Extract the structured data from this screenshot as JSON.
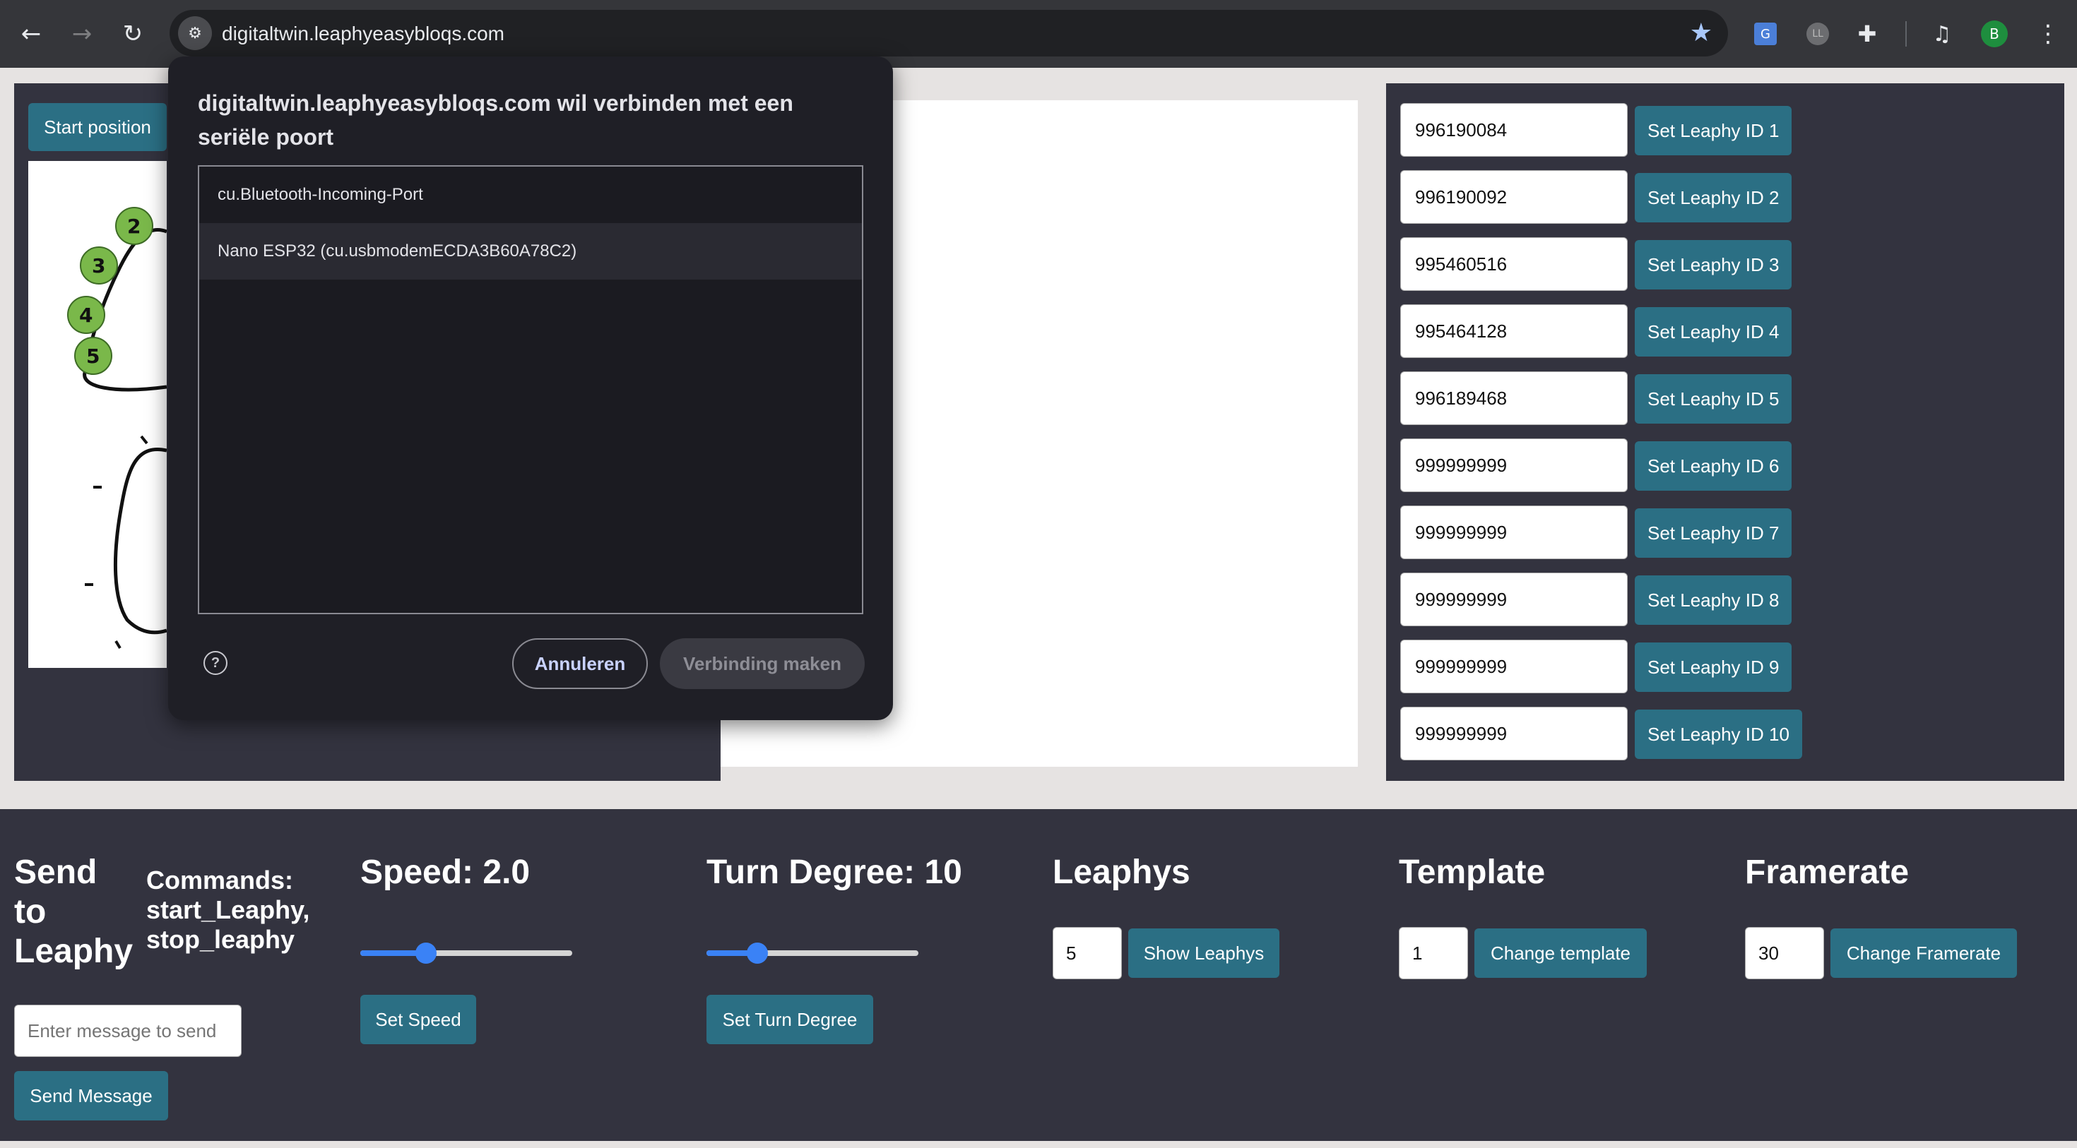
{
  "browser": {
    "url": "digitaltwin.leaphyeasybloqs.com",
    "back_icon": "←",
    "forward_icon": "→",
    "reload_icon": "↻",
    "site_info_icon": "⚙",
    "star_icon": "★",
    "translate_icon": "G",
    "extension_ll": "LL",
    "puzzle_icon": "✚",
    "media_icon": "♫",
    "profile_initial": "B",
    "menu_icon": "⋮"
  },
  "left_panel": {
    "start_button": "Start position",
    "leaphy_labels": [
      "2",
      "3",
      "4",
      "5"
    ]
  },
  "dialog": {
    "title": "digitaltwin.leaphyeasybloqs.com wil verbinden met een seriële poort",
    "ports": [
      "cu.Bluetooth-Incoming-Port",
      "Nano ESP32 (cu.usbmodemECDA3B60A78C2)"
    ],
    "help_icon": "?",
    "cancel_label": "Annuleren",
    "connect_label": "Verbinding maken"
  },
  "leaphy_ids": [
    {
      "value": "996190084",
      "button": "Set Leaphy ID 1"
    },
    {
      "value": "996190092",
      "button": "Set Leaphy ID 2"
    },
    {
      "value": "995460516",
      "button": "Set Leaphy ID 3"
    },
    {
      "value": "995464128",
      "button": "Set Leaphy ID 4"
    },
    {
      "value": "996189468",
      "button": "Set Leaphy ID 5"
    },
    {
      "value": "999999999",
      "button": "Set Leaphy ID 6"
    },
    {
      "value": "999999999",
      "button": "Set Leaphy ID 7"
    },
    {
      "value": "999999999",
      "button": "Set Leaphy ID 8"
    },
    {
      "value": "999999999",
      "button": "Set Leaphy ID 9"
    },
    {
      "value": "999999999",
      "button": "Set Leaphy ID 10"
    }
  ],
  "bottom": {
    "send": {
      "title_line1": "Send",
      "title_line2": "to",
      "title_line3": "Leaphy",
      "commands_line1": "Commands:",
      "commands_line2": "start_Leaphy,",
      "commands_line3": "stop_leaphy",
      "placeholder": "Enter message to send",
      "button": "Send Message"
    },
    "speed": {
      "title": "Speed: 2.0",
      "level": 0.29,
      "button": "Set Speed"
    },
    "turn": {
      "title": "Turn Degree: 10",
      "level": 0.21,
      "button": "Set Turn Degree"
    },
    "leaphys": {
      "title": "Leaphys",
      "value": "5",
      "button": "Show Leaphys"
    },
    "template": {
      "title": "Template",
      "value": "1",
      "button": "Change template"
    },
    "framerate": {
      "title": "Framerate",
      "value": "30",
      "button": "Change Framerate"
    }
  }
}
